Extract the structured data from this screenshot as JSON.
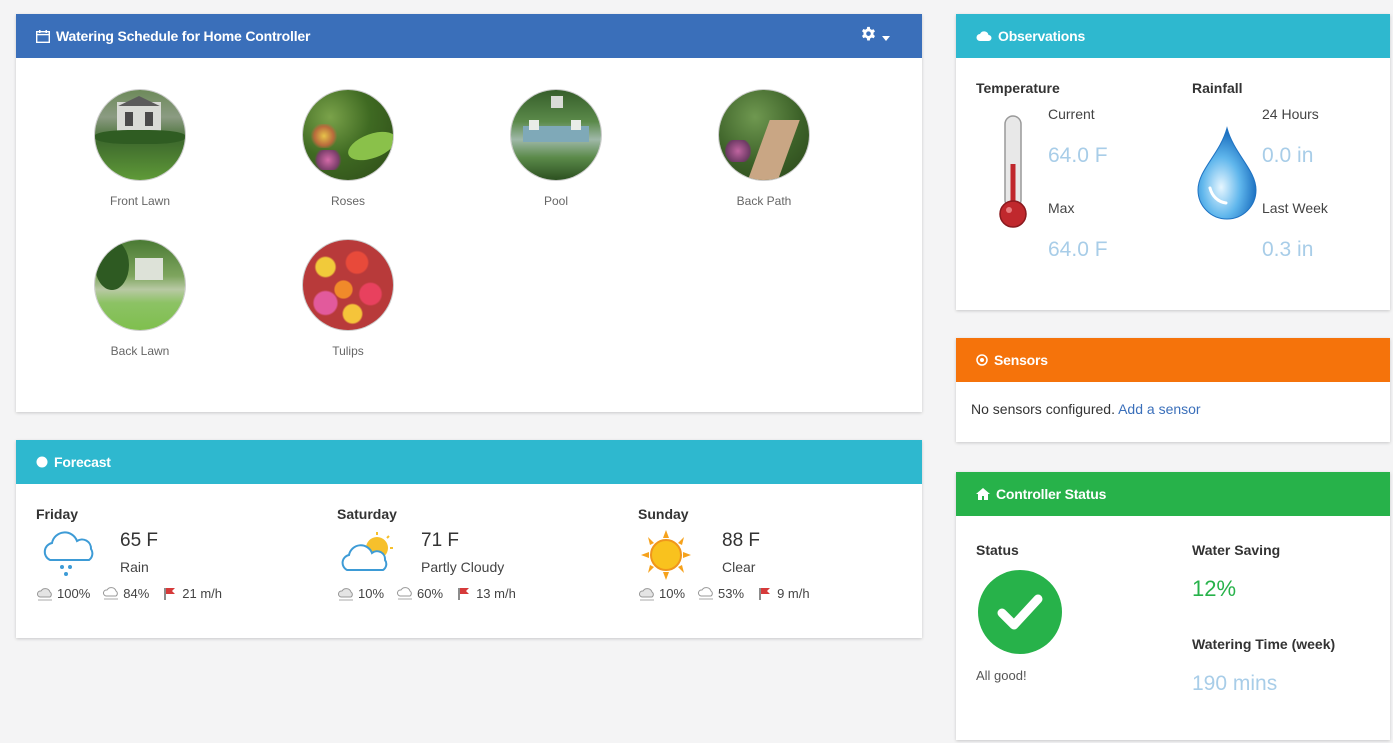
{
  "schedule": {
    "title": "Watering Schedule for Home Controller",
    "zones": [
      {
        "label": "Front Lawn",
        "icon": "front-lawn-photo"
      },
      {
        "label": "Roses",
        "icon": "roses-photo"
      },
      {
        "label": "Pool",
        "icon": "pool-photo"
      },
      {
        "label": "Back Path",
        "icon": "back-path-photo"
      },
      {
        "label": "Back Lawn",
        "icon": "back-lawn-photo"
      },
      {
        "label": "Tulips",
        "icon": "tulips-photo"
      }
    ]
  },
  "forecast": {
    "title": "Forecast",
    "days": [
      {
        "name": "Friday",
        "temp": "65 F",
        "condition": "Rain",
        "icon": "rain-cloud-icon",
        "precip": "100%",
        "humidity": "84%",
        "wind": "21 m/h"
      },
      {
        "name": "Saturday",
        "temp": "71 F",
        "condition": "Partly Cloudy",
        "icon": "partly-cloudy-icon",
        "precip": "10%",
        "humidity": "60%",
        "wind": "13 m/h"
      },
      {
        "name": "Sunday",
        "temp": "88 F",
        "condition": "Clear",
        "icon": "sun-icon",
        "precip": "10%",
        "humidity": "53%",
        "wind": "9 m/h"
      }
    ]
  },
  "observations": {
    "title": "Observations",
    "temperature": {
      "heading": "Temperature",
      "current_label": "Current",
      "current": "64.0 F",
      "max_label": "Max",
      "max": "64.0 F"
    },
    "rainfall": {
      "heading": "Rainfall",
      "h24_label": "24 Hours",
      "h24": "0.0 in",
      "week_label": "Last Week",
      "week": "0.3 in"
    }
  },
  "sensors": {
    "title": "Sensors",
    "text": "No sensors configured.",
    "link": "Add a sensor"
  },
  "controller": {
    "title": "Controller Status",
    "status_label": "Status",
    "status_text": "All good!",
    "saving_label": "Water Saving",
    "saving": "12%",
    "time_label": "Watering Time (week)",
    "time": "190 mins"
  },
  "colors": {
    "schedule_header": "#3a6fba",
    "forecast_header": "#2eb8cf",
    "observations_header": "#2eb8cf",
    "sensors_header": "#f5730b",
    "controller_header": "#27b24a",
    "value_text": "#a8cde8"
  }
}
